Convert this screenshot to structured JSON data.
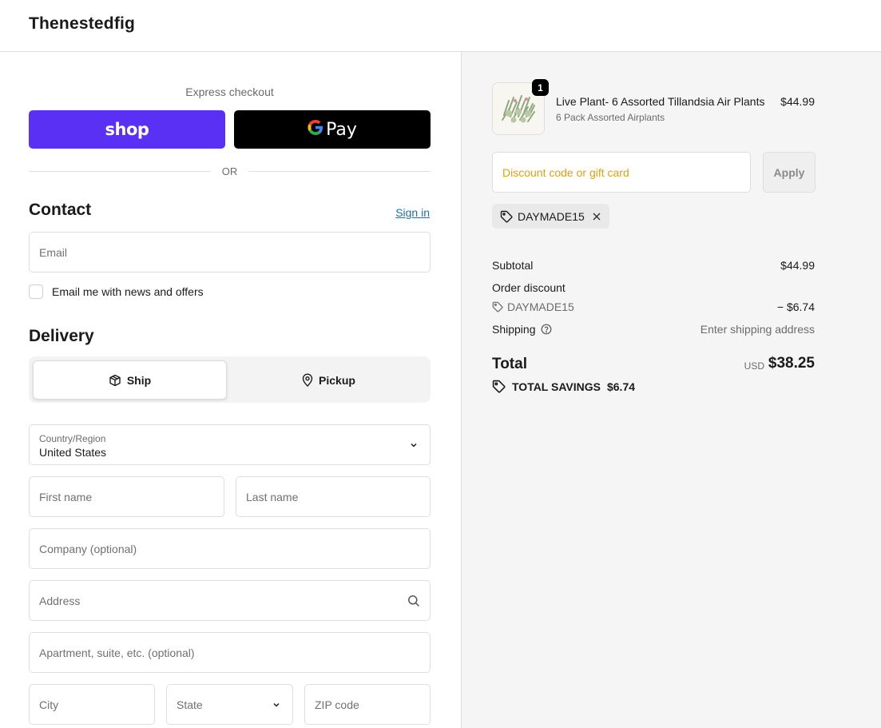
{
  "header": {
    "store_name": "Thenestedfig"
  },
  "express": {
    "label": "Express checkout",
    "shop_label": "shop",
    "gpay_g": "G",
    "gpay_label": "Pay",
    "or_label": "OR"
  },
  "contact": {
    "title": "Contact",
    "sign_in": "Sign in",
    "email_placeholder": "Email",
    "newsletter_label": "Email me with news and offers"
  },
  "delivery": {
    "title": "Delivery",
    "ship_label": "Ship",
    "pickup_label": "Pickup",
    "country_label": "Country/Region",
    "country_value": "United States",
    "first_name_placeholder": "First name",
    "last_name_placeholder": "Last name",
    "company_placeholder": "Company (optional)",
    "address_placeholder": "Address",
    "apartment_placeholder": "Apartment, suite, etc. (optional)",
    "city_placeholder": "City",
    "state_placeholder": "State",
    "zip_placeholder": "ZIP code"
  },
  "cart": {
    "item": {
      "title": "Live Plant- 6 Assorted Tillandsia Air Plants",
      "variant": "6 Pack Assorted Airplants",
      "price": "$44.99",
      "quantity": "1"
    },
    "discount_placeholder": "Discount code or gift card",
    "apply_label": "Apply",
    "applied_code": "DAYMADE15"
  },
  "summary": {
    "subtotal_label": "Subtotal",
    "subtotal_value": "$44.99",
    "order_discount_label": "Order discount",
    "discount_code": "DAYMADE15",
    "discount_value": "− $6.74",
    "shipping_label": "Shipping",
    "shipping_value": "Enter shipping address",
    "total_label": "Total",
    "currency": "USD",
    "total_value": "$38.25",
    "savings_label": "TOTAL SAVINGS",
    "savings_value": "$6.74"
  },
  "colors": {
    "shop_purple": "#5a31f4",
    "link_blue": "#1773b0",
    "discount_placeholder": "#e0a111"
  },
  "icons": [
    "box-icon",
    "map-pin-icon",
    "chevron-down-icon",
    "search-icon",
    "tag-icon",
    "close-icon",
    "help-circle-icon",
    "google-g-icon"
  ]
}
